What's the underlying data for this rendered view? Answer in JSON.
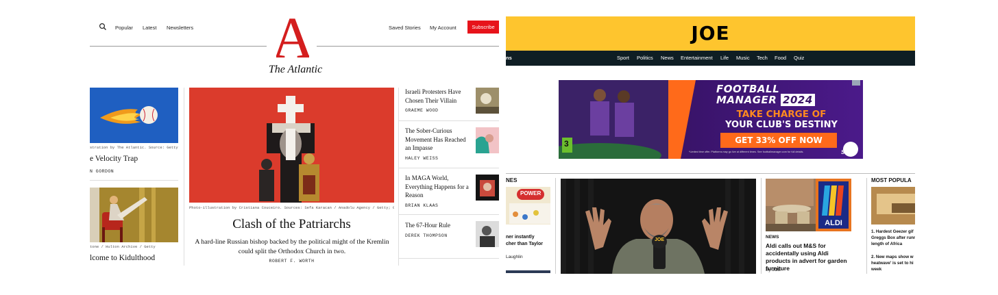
{
  "atlantic": {
    "nav": {
      "popular": "Popular",
      "latest": "Latest",
      "newsletters": "Newsletters",
      "saved_stories": "Saved Stories",
      "my_account": "My Account",
      "subscribe": "Subscribe"
    },
    "logo": {
      "letter": "A",
      "name": "The Atlantic"
    },
    "left_column": [
      {
        "caption": "stration by The Atlantic. Source: Getty",
        "title": "e Velocity Trap",
        "byline": "N GORDON"
      },
      {
        "caption": "tone / Hulton Archive / Getty",
        "title": "lcome to Kidulthood"
      }
    ],
    "main_story": {
      "caption": "Photo-illustration by Cristiana Couceiro. Sources: Sefa Karacan / Anadolu Agency / Getty; Get…",
      "title": "Clash of the Patriarchs",
      "dek": "A hard-line Russian bishop backed by the political might of the Kremlin could split the Orthodox Church in two.",
      "byline": "ROBERT F. WORTH"
    },
    "side_stories": [
      {
        "title": "Israeli Protesters Have Chosen Their Villain",
        "byline": "GRAEME WOOD"
      },
      {
        "title": "The Sober-Curious Movement Has Reached an Impasse",
        "byline": "HALEY WEISS"
      },
      {
        "title": "In MAGA World, Everything Happens for a Reason",
        "byline": "BRIAN KLAAS"
      },
      {
        "title": "The 67-Hour Rule",
        "byline": "DEREK THOMPSON"
      }
    ],
    "colors": {
      "red": "#e7131a",
      "hero_red": "#db3b2c",
      "sky_blue": "#1f5fc1"
    }
  },
  "joe": {
    "logo": "JOE",
    "nav_partial": "ns",
    "nav": [
      "Sport",
      "Politics",
      "News",
      "Entertainment",
      "Life",
      "Music",
      "Tech",
      "Food",
      "Quiz"
    ],
    "ad": {
      "headline_1": "FOOTBALL",
      "headline_2": "MANAGER",
      "year": "2024",
      "tagline_1": "TAKE CHARGE OF",
      "tagline_2": "YOUR CLUB'S DESTINY",
      "cta": "GET 33% OFF NOW",
      "rating": "3",
      "publisher": "SEGA",
      "fine_print": "*Limited time offer. Platforms may go live at different times. See footballmanager.com for full details."
    },
    "left_section": {
      "header": "NES",
      "lottery_text": "POWER",
      "headline": "ner instantly\ncher than Taylor",
      "footer": "Laughlin"
    },
    "video_mug": "JOE",
    "article": {
      "tag": "NEWS",
      "title": "Aldi calls out M&S for accidentally using Aldi products in advert for garden furniture",
      "byline": "By JOE",
      "logo": "ALDI"
    },
    "most_popular": {
      "header": "MOST POPULA",
      "items": [
        "1. Hardest Geezer gif\nGreggs Box after runn\nlength of Africa",
        "2. New maps show w\nheatwave' is set to hi\nweek"
      ]
    },
    "colors": {
      "yellow": "#fec52e",
      "nav": "#0f1e24",
      "ad_purple": "#3a1466",
      "ad_orange": "#ff6a1a",
      "aldi_blue": "#1b2a86"
    }
  }
}
